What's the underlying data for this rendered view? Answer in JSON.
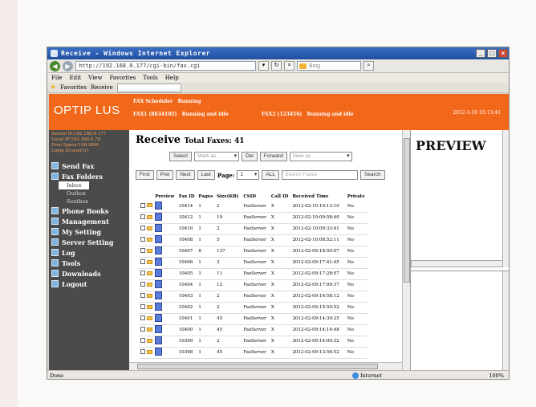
{
  "window": {
    "title": "Receive - Windows Internet Explorer",
    "address": "http://192.168.0.177/cgi-bin/fax.cgi",
    "search_placeholder": "Bing",
    "menu": [
      "File",
      "Edit",
      "View",
      "Favorites",
      "Tools",
      "Help"
    ],
    "favorites_label": "Favorites",
    "tab_label": "Receive"
  },
  "header": {
    "brand": "OPTIP LUS",
    "status_lines": [
      {
        "label": "FAX Scheduler",
        "status": "Running"
      },
      {
        "label": "FAX1 (8634102)",
        "status": "Running and idle"
      },
      {
        "label": "FAX2 (123456)",
        "status": "Running and idle"
      }
    ],
    "clock": "2012-3-10 10:13:41"
  },
  "sidebar": {
    "info": [
      "Server IP:192.168.0.177",
      "Local IP:192.168.0.70",
      "Free Space:136.26M",
      "Login ID:user1()"
    ],
    "items": [
      {
        "label": "Send Fax"
      },
      {
        "label": "Fax Folders"
      },
      {
        "label": "Phone Books"
      },
      {
        "label": "Management"
      },
      {
        "label": "My Setting"
      },
      {
        "label": "Server Setting"
      },
      {
        "label": "Log"
      },
      {
        "label": "Tools"
      },
      {
        "label": "Downloads"
      },
      {
        "label": "Logout"
      }
    ],
    "subitems": [
      "Inbox",
      "Outbox",
      "Sentbox"
    ]
  },
  "main": {
    "title": "Receive",
    "total_label": "Total Faxes: 41",
    "select_btn": "Select",
    "mark_as": "Mark as",
    "del_btn": "Del",
    "forward_btn": "Forward",
    "view_as": "View as",
    "first_btn": "First",
    "prev_btn": "Prei",
    "next_btn": "Next",
    "last_btn": "Last",
    "page_label": "Page:",
    "page_value": "1",
    "all_btn": "ALL",
    "search_placeholder": "Search Faxes",
    "search_btn": "Search",
    "columns": [
      "Preview",
      "Fax ID",
      "Pages",
      "Size(KB)",
      "CSID",
      "Call ID",
      "Received Time",
      "Private"
    ],
    "rows": [
      [
        "10414",
        "1",
        "2",
        "FaxServer",
        "X",
        "2012-02-10:10:13:10",
        "No"
      ],
      [
        "10412",
        "1",
        "19",
        "FaxServer",
        "X",
        "2012-02-10:09:58:40",
        "No"
      ],
      [
        "10410",
        "1",
        "2",
        "FaxServer",
        "X",
        "2012-02-10:09:33:41",
        "No"
      ],
      [
        "10408",
        "1",
        "5",
        "FaxServer",
        "X",
        "2012-02-10:08:52:11",
        "No"
      ],
      [
        "10407",
        "8",
        "137",
        "FaxServer",
        "X",
        "2012-02-09:18:50:07",
        "No"
      ],
      [
        "10406",
        "1",
        "2",
        "FaxServer",
        "X",
        "2012-02-09:17:41:45",
        "No"
      ],
      [
        "10405",
        "1",
        "11",
        "FaxServer",
        "X",
        "2012-02-09:17:28:07",
        "No"
      ],
      [
        "10404",
        "1",
        "12",
        "FaxServer",
        "X",
        "2012-02-09:17:09:37",
        "No"
      ],
      [
        "10403",
        "1",
        "2",
        "FaxServer",
        "X",
        "2012-02-09:16:58:12",
        "No"
      ],
      [
        "10402",
        "1",
        "2",
        "FaxServer",
        "X",
        "2012-02-09:15:59:52",
        "No"
      ],
      [
        "10401",
        "1",
        "45",
        "FaxServer",
        "X",
        "2012-02-09:14:30:25",
        "No"
      ],
      [
        "10400",
        "1",
        "45",
        "FaxServer",
        "X",
        "2012-02-09:14:14:48",
        "No"
      ],
      [
        "10399",
        "1",
        "2",
        "FaxServer",
        "X",
        "2012-02-09:14:00:32",
        "No"
      ],
      [
        "10398",
        "1",
        "45",
        "FaxServer",
        "X",
        "2012-02-09:13:56:52",
        "No"
      ]
    ]
  },
  "preview": {
    "title": "PREVIEW"
  },
  "statusbar": {
    "left": "Done",
    "zone": "Internet",
    "zoom": "100%"
  }
}
